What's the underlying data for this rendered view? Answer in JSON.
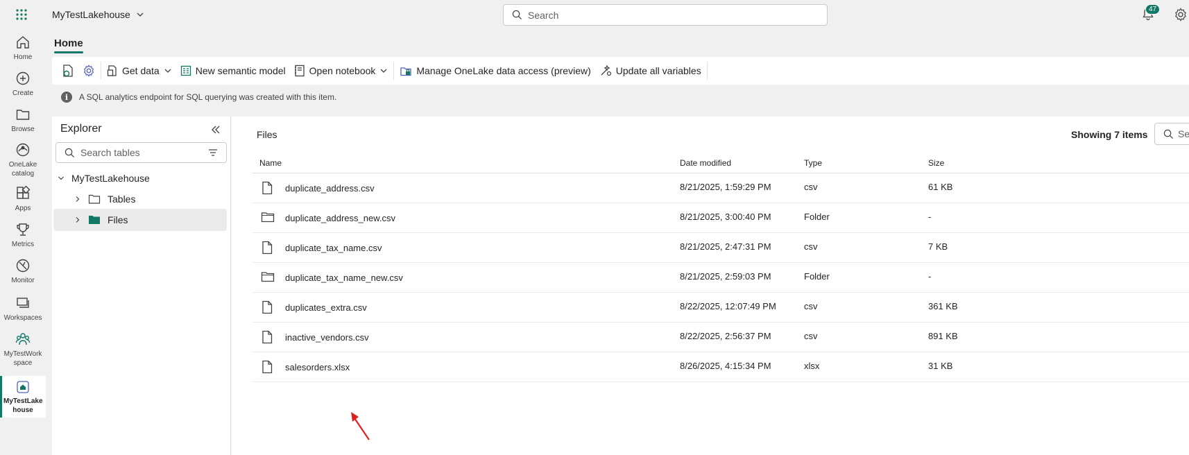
{
  "topbar": {
    "workspace_name": "MyTestLakehouse",
    "search_placeholder": "Search",
    "notification_count": "47"
  },
  "rail": [
    {
      "label": "Home",
      "icon": "home-icon"
    },
    {
      "label": "Create",
      "icon": "plus-circle-icon"
    },
    {
      "label": "Browse",
      "icon": "folder-icon"
    },
    {
      "label": "OneLake catalog",
      "icon": "onelake-icon"
    },
    {
      "label": "Apps",
      "icon": "apps-icon"
    },
    {
      "label": "Metrics",
      "icon": "trophy-icon"
    },
    {
      "label": "Monitor",
      "icon": "monitor-icon"
    },
    {
      "label": "Workspaces",
      "icon": "workspaces-icon"
    },
    {
      "label": "MyTestWork space",
      "icon": "workspace-people-icon"
    },
    {
      "label": "MyTestLake house",
      "icon": "lakehouse-icon"
    }
  ],
  "home_tab": "Home",
  "ribbon": {
    "get_data": "Get data",
    "new_semantic_model": "New semantic model",
    "open_notebook": "Open notebook",
    "manage_onelake": "Manage OneLake data access (preview)",
    "update_variables": "Update all variables"
  },
  "info_message": "A SQL analytics endpoint for SQL querying was created with this item.",
  "explorer": {
    "title": "Explorer",
    "search_placeholder": "Search tables",
    "root": "MyTestLakehouse",
    "nodes": [
      "Tables",
      "Files"
    ]
  },
  "files": {
    "title": "Files",
    "showing": "Showing 7 items",
    "search_placeholder": "Sea",
    "columns": {
      "name": "Name",
      "date": "Date modified",
      "type": "Type",
      "size": "Size"
    },
    "rows": [
      {
        "name": "duplicate_address.csv",
        "date": "8/21/2025, 1:59:29 PM",
        "type": "csv",
        "size": "61 KB",
        "kind": "file"
      },
      {
        "name": "duplicate_address_new.csv",
        "date": "8/21/2025, 3:00:40 PM",
        "type": "Folder",
        "size": "-",
        "kind": "folder"
      },
      {
        "name": "duplicate_tax_name.csv",
        "date": "8/21/2025, 2:47:31 PM",
        "type": "csv",
        "size": "7 KB",
        "kind": "file"
      },
      {
        "name": "duplicate_tax_name_new.csv",
        "date": "8/21/2025, 2:59:03 PM",
        "type": "Folder",
        "size": "-",
        "kind": "folder"
      },
      {
        "name": "duplicates_extra.csv",
        "date": "8/22/2025, 12:07:49 PM",
        "type": "csv",
        "size": "361 KB",
        "kind": "file"
      },
      {
        "name": "inactive_vendors.csv",
        "date": "8/22/2025, 2:56:37 PM",
        "type": "csv",
        "size": "891 KB",
        "kind": "file"
      },
      {
        "name": "salesorders.xlsx",
        "date": "8/26/2025, 4:15:34 PM",
        "type": "xlsx",
        "size": "31 KB",
        "kind": "file"
      }
    ]
  },
  "colors": {
    "accent": "#117865",
    "annotation_arrow": "#e02020"
  }
}
